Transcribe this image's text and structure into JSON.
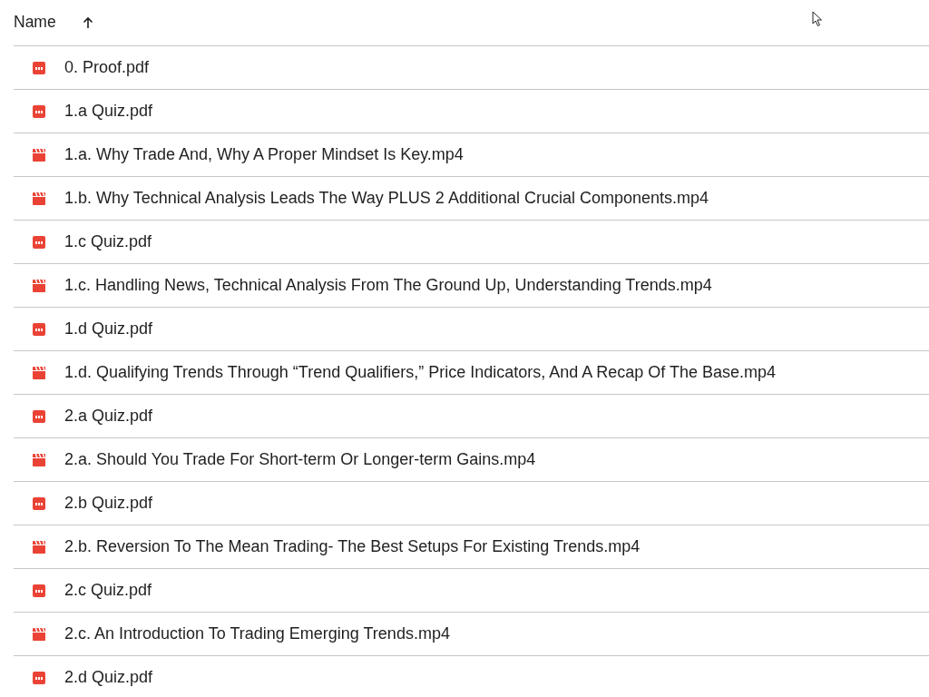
{
  "header": {
    "label": "Name",
    "sort_ascending": true
  },
  "rows": [
    {
      "name": "0. Proof.pdf",
      "kind": "pdf"
    },
    {
      "name": "1.a Quiz.pdf",
      "kind": "pdf"
    },
    {
      "name": "1.a. Why Trade And, Why A Proper Mindset Is Key.mp4",
      "kind": "video"
    },
    {
      "name": "1.b. Why Technical Analysis Leads The Way PLUS 2 Additional Crucial Components.mp4",
      "kind": "video"
    },
    {
      "name": "1.c Quiz.pdf",
      "kind": "pdf"
    },
    {
      "name": "1.c. Handling News, Technical Analysis From The Ground Up, Understanding Trends.mp4",
      "kind": "video"
    },
    {
      "name": "1.d Quiz.pdf",
      "kind": "pdf"
    },
    {
      "name": "1.d. Qualifying Trends Through “Trend Qualifiers,” Price Indicators, And A Recap Of The Base.mp4",
      "kind": "video"
    },
    {
      "name": "2.a Quiz.pdf",
      "kind": "pdf"
    },
    {
      "name": "2.a. Should You Trade For Short-term Or Longer-term Gains.mp4",
      "kind": "video"
    },
    {
      "name": "2.b Quiz.pdf",
      "kind": "pdf"
    },
    {
      "name": "2.b. Reversion To The Mean Trading- The Best Setups For Existing Trends.mp4",
      "kind": "video"
    },
    {
      "name": "2.c Quiz.pdf",
      "kind": "pdf"
    },
    {
      "name": "2.c. An Introduction To Trading Emerging Trends.mp4",
      "kind": "video"
    },
    {
      "name": "2.d Quiz.pdf",
      "kind": "pdf"
    }
  ]
}
